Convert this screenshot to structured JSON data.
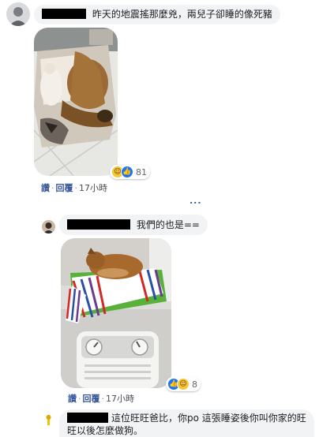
{
  "comments": [
    {
      "text": "昨天的地震搖那麼兇，兩兒子卻睡的像死豬",
      "actions": {
        "like": "讚",
        "reply": "回覆",
        "time": "17小時"
      },
      "reaction_count": "81",
      "reaction_icons": [
        "haha-icon",
        "like-icon"
      ]
    },
    {
      "text": "我們的也是==",
      "actions": {
        "like": "讚",
        "reply": "回覆",
        "time": "17小時"
      },
      "reaction_count": "8",
      "reaction_icons": [
        "like-icon",
        "haha-icon"
      ]
    },
    {
      "text_line1": "這位旺旺爸比，你po 這張睡姿後你叫你家的旺",
      "text_line2": "旺以後怎麼做狗。"
    }
  ],
  "more_replies": "...",
  "colors": {
    "link": "#385898",
    "bubble": "#f2f3f5",
    "like_blue": "#1877f2",
    "haha_yellow": "#f7c535"
  }
}
